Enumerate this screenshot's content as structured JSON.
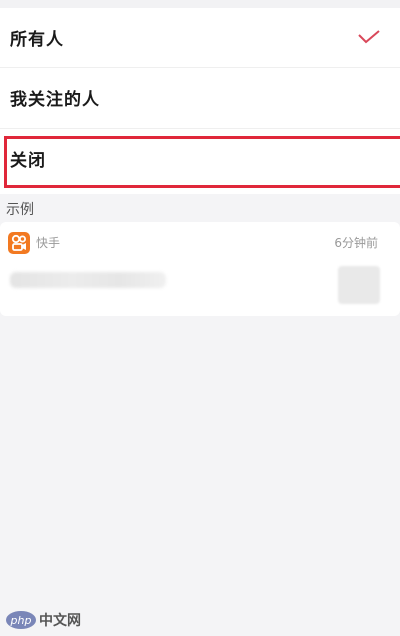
{
  "options": [
    {
      "label": "所有人",
      "selected": true
    },
    {
      "label": "我关注的人",
      "selected": false
    },
    {
      "label": "关闭",
      "selected": false
    }
  ],
  "section": {
    "label": "示例"
  },
  "card": {
    "app_name": "快手",
    "time": "6分钟前",
    "app_icon": "kuaishou-icon",
    "icon_color": "#f27921"
  },
  "accent_color": "#e0283a",
  "watermark": {
    "logo": "php",
    "text": "中文网"
  }
}
